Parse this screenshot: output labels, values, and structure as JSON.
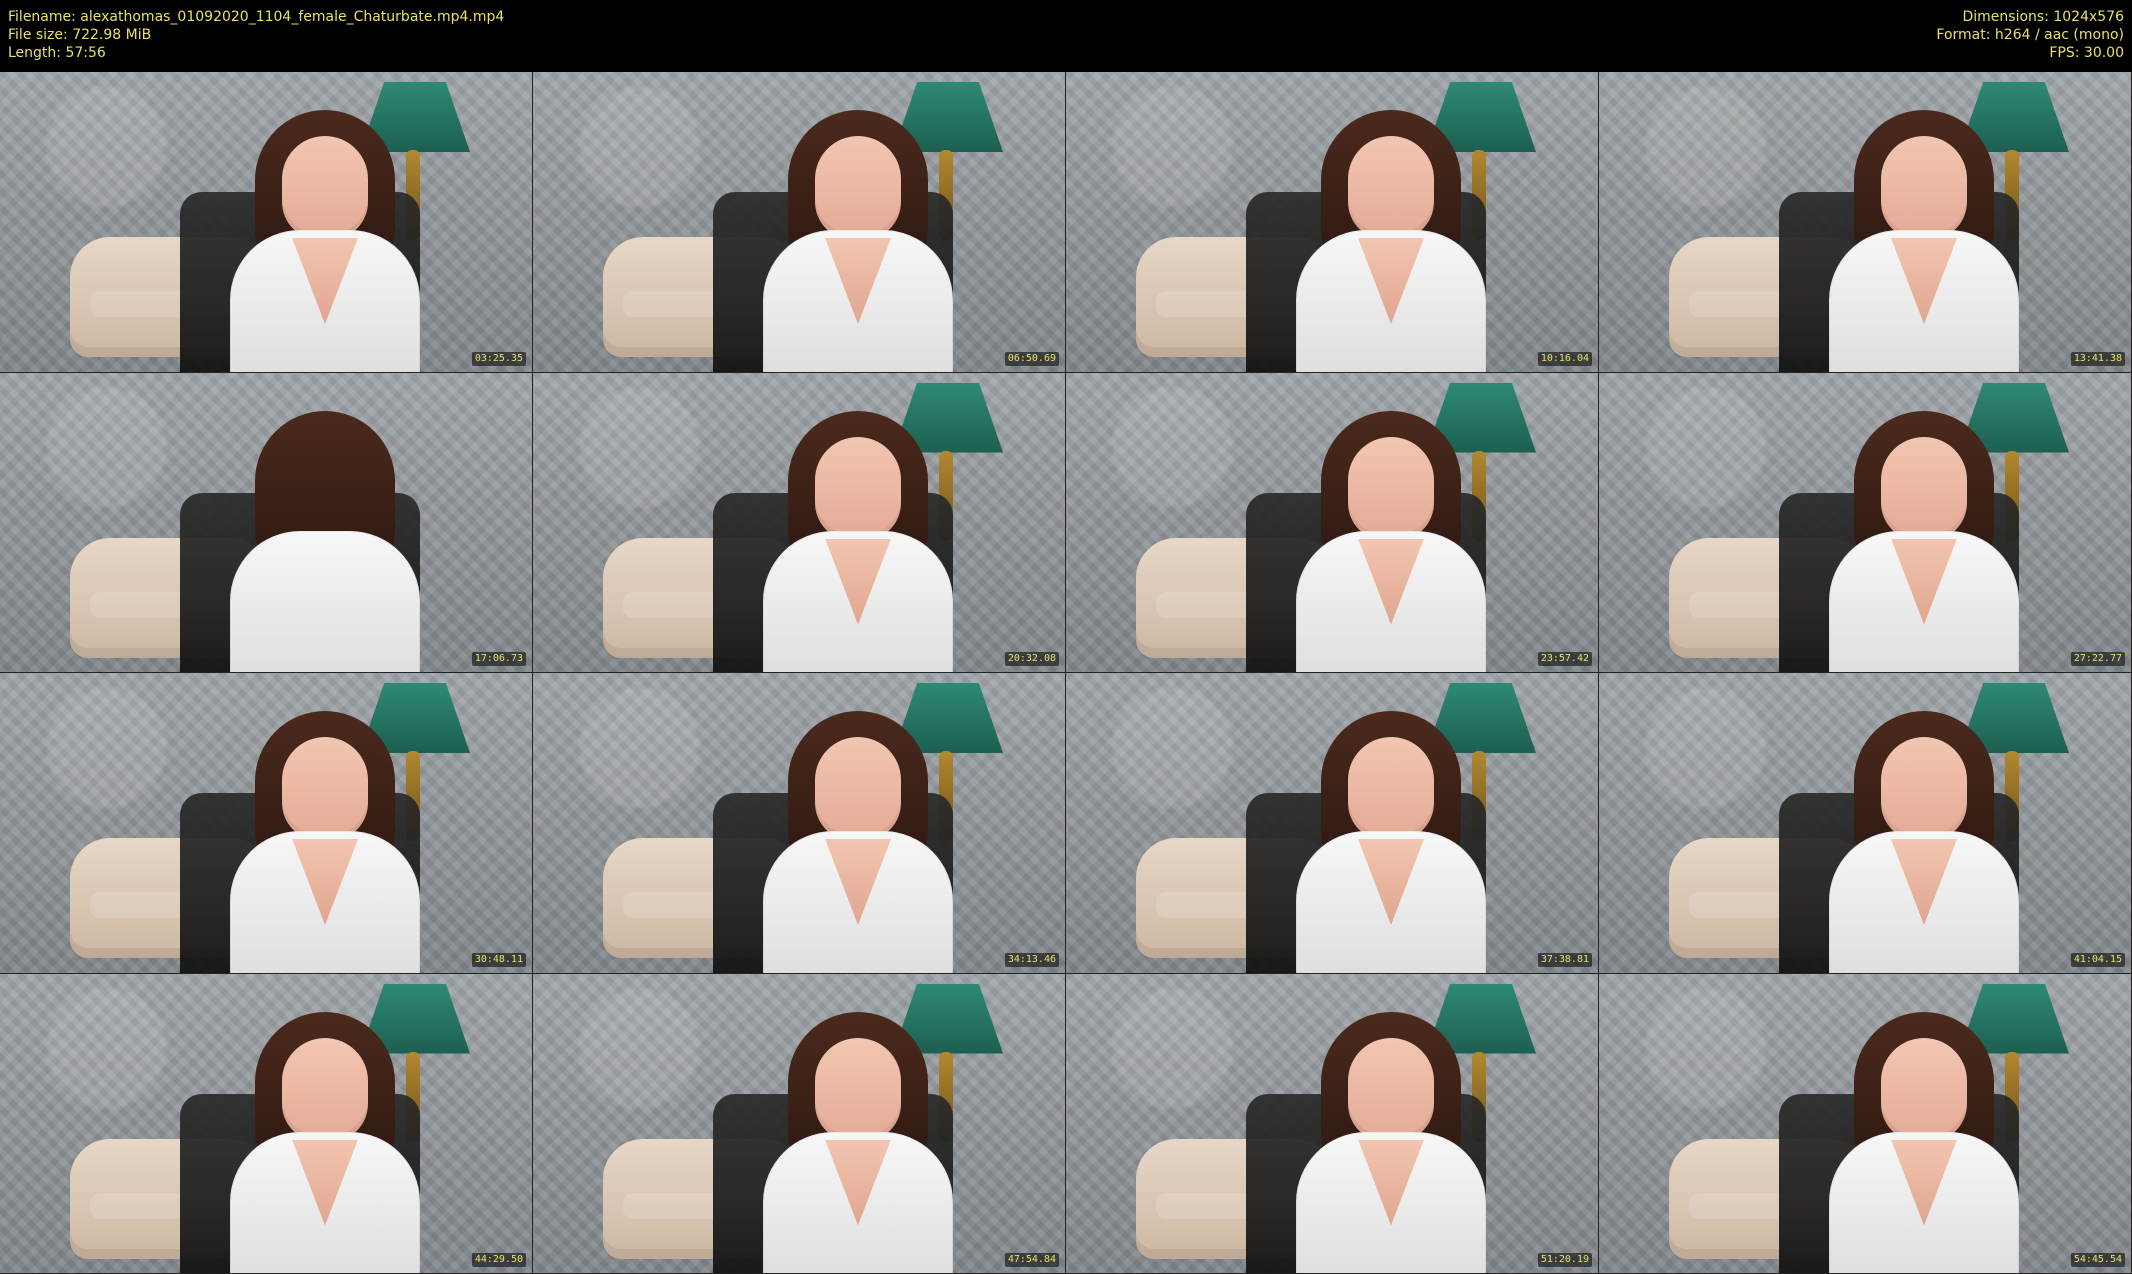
{
  "header": {
    "filename": "Filename: alexathomas_01092020_1104_female_Chaturbate.mp4.mp4",
    "file_size": "File size: 722.98 MiB",
    "length": "Length: 57:56",
    "dimensions": "Dimensions: 1024x576",
    "format": "Format: h264 / aac (mono)",
    "fps": "FPS: 30.00"
  },
  "thumbnails": [
    {
      "timestamp": "03:25.35"
    },
    {
      "timestamp": "06:50.69"
    },
    {
      "timestamp": "10:16.04"
    },
    {
      "timestamp": "13:41.38"
    },
    {
      "timestamp": "17:06.73"
    },
    {
      "timestamp": "20:32.08"
    },
    {
      "timestamp": "23:57.42"
    },
    {
      "timestamp": "27:22.77"
    },
    {
      "timestamp": "30:48.11"
    },
    {
      "timestamp": "34:13.46"
    },
    {
      "timestamp": "37:38.81"
    },
    {
      "timestamp": "41:04.15"
    },
    {
      "timestamp": "44:29.50"
    },
    {
      "timestamp": "47:54.84"
    },
    {
      "timestamp": "51:20.19"
    },
    {
      "timestamp": "54:45.54"
    }
  ],
  "colors": {
    "header_text": "#e8e06a",
    "background": "#000000"
  }
}
